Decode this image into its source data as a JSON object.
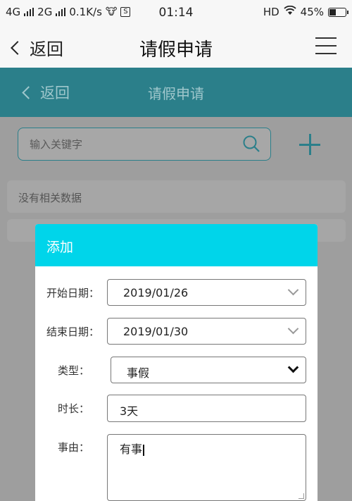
{
  "statusbar": {
    "left": [
      "4G",
      "2G",
      "0.1K/s",
      "S"
    ],
    "time": "01:14",
    "hd": "HD",
    "battery": "45%",
    "battery_level": 0.45
  },
  "navbar": {
    "back": "返回",
    "title": "请假申请"
  },
  "page": {
    "header_back": "返回",
    "header_title": "请假申请",
    "search_placeholder": "输入关键字",
    "no_data": "没有相关数据"
  },
  "modal": {
    "title": "添加",
    "start_label": "开始日期：",
    "start_value": "2019/01/26",
    "end_label": "结束日期：",
    "end_value": "2019/01/30",
    "type_label": "类型：",
    "type_value": "事假",
    "duration_label": "时长：",
    "duration_value": "3天",
    "reason_label": "事由：",
    "reason_value": "有事"
  },
  "colors": {
    "accent": "#00d5ea",
    "teal": "#2b7f8a",
    "overlay": "#9e9e9e"
  }
}
